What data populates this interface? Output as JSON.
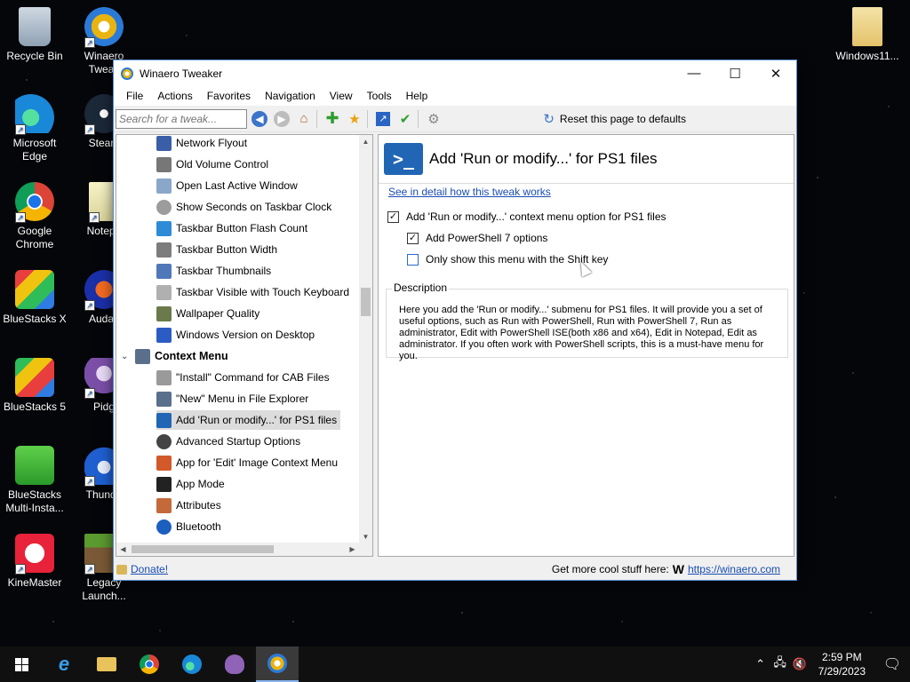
{
  "desktop": {
    "icons": [
      {
        "label": "Recycle Bin"
      },
      {
        "label": "Winaero Tweak"
      },
      {
        "label": "Microsoft Edge"
      },
      {
        "label": "Steam"
      },
      {
        "label": "Google Chrome"
      },
      {
        "label": "Notepa"
      },
      {
        "label": "BlueStacks X"
      },
      {
        "label": "Audac"
      },
      {
        "label": "BlueStacks 5"
      },
      {
        "label": "Pidg"
      },
      {
        "label": "BlueStacks Multi-Insta..."
      },
      {
        "label": "Thunde"
      },
      {
        "label": "KineMaster"
      },
      {
        "label": "Legacy Launch..."
      },
      {
        "label": "Windows11..."
      }
    ]
  },
  "window": {
    "title": "Winaero Tweaker",
    "controls": {
      "minimize": "—",
      "maximize": "☐",
      "close": "✕"
    },
    "menu": [
      "File",
      "Actions",
      "Favorites",
      "Navigation",
      "View",
      "Tools",
      "Help"
    ],
    "toolbar": {
      "search_placeholder": "Search for a tweak...",
      "reset_label": "Reset this page to defaults"
    },
    "tree": {
      "items_before": [
        {
          "label": "Network Flyout",
          "color": "#3a5fa8"
        },
        {
          "label": "Old Volume Control",
          "color": "#777777"
        },
        {
          "label": "Open Last Active Window",
          "color": "#8aa7c9"
        },
        {
          "label": "Show Seconds on Taskbar Clock",
          "color": "#9c9c9c"
        },
        {
          "label": "Taskbar Button Flash Count",
          "color": "#2e8bd6"
        },
        {
          "label": "Taskbar Button Width",
          "color": "#7d7d7d"
        },
        {
          "label": "Taskbar Thumbnails",
          "color": "#4f78b8"
        },
        {
          "label": "Taskbar Visible with Touch Keyboard",
          "color": "#b0b0b0"
        },
        {
          "label": "Wallpaper Quality",
          "color": "#6b7a4a"
        },
        {
          "label": "Windows Version on Desktop",
          "color": "#2a5cc4"
        }
      ],
      "category": {
        "label": "Context Menu",
        "expander": "⌄"
      },
      "items_after": [
        {
          "label": "\"Install\" Command for CAB Files",
          "color": "#9a9a9a"
        },
        {
          "label": "\"New\" Menu in File Explorer",
          "color": "#5a6f8c"
        },
        {
          "label": "Add 'Run or modify...' for PS1 files",
          "color": "#2166b5",
          "selected": true
        },
        {
          "label": "Advanced Startup Options",
          "color": "#444444"
        },
        {
          "label": "App for 'Edit' Image Context Menu",
          "color": "#d25a2a"
        },
        {
          "label": "App Mode",
          "color": "#222222"
        },
        {
          "label": "Attributes",
          "color": "#c46a3a"
        },
        {
          "label": "Bluetooth",
          "color": "#1b5fbf"
        }
      ]
    },
    "panel": {
      "title": "Add 'Run or modify...' for PS1 files",
      "icon_glyph": ">_",
      "detail_link": "See in detail how this tweak works",
      "options": [
        {
          "label": "Add 'Run or modify...' context menu option for PS1 files",
          "checked": "✓"
        },
        {
          "label": "Add PowerShell 7 options",
          "checked": "✓"
        },
        {
          "label": "Only show this menu with the Shift key",
          "checked": ""
        }
      ],
      "description_legend": "Description",
      "description": "Here you add the 'Run or modify...' submenu for PS1 files. It will provide you a set of useful options, such as Run with PowerShell, Run with PowerShell 7, Run as administrator, Edit with PowerShell ISE(both x86 and x64), Edit in Notepad, Edit as administrator. If you often work with PowerShell scripts, this is a must-have menu for you."
    },
    "status": {
      "donate": "Donate!",
      "cool_stuff": "Get more cool stuff here:",
      "url": "https://winaero.com"
    }
  },
  "taskbar": {
    "time": "2:59 PM",
    "date": "7/29/2023"
  },
  "colors": {
    "accent": "#2166b5",
    "link": "#1a4db3",
    "taskbar": "#101010"
  }
}
